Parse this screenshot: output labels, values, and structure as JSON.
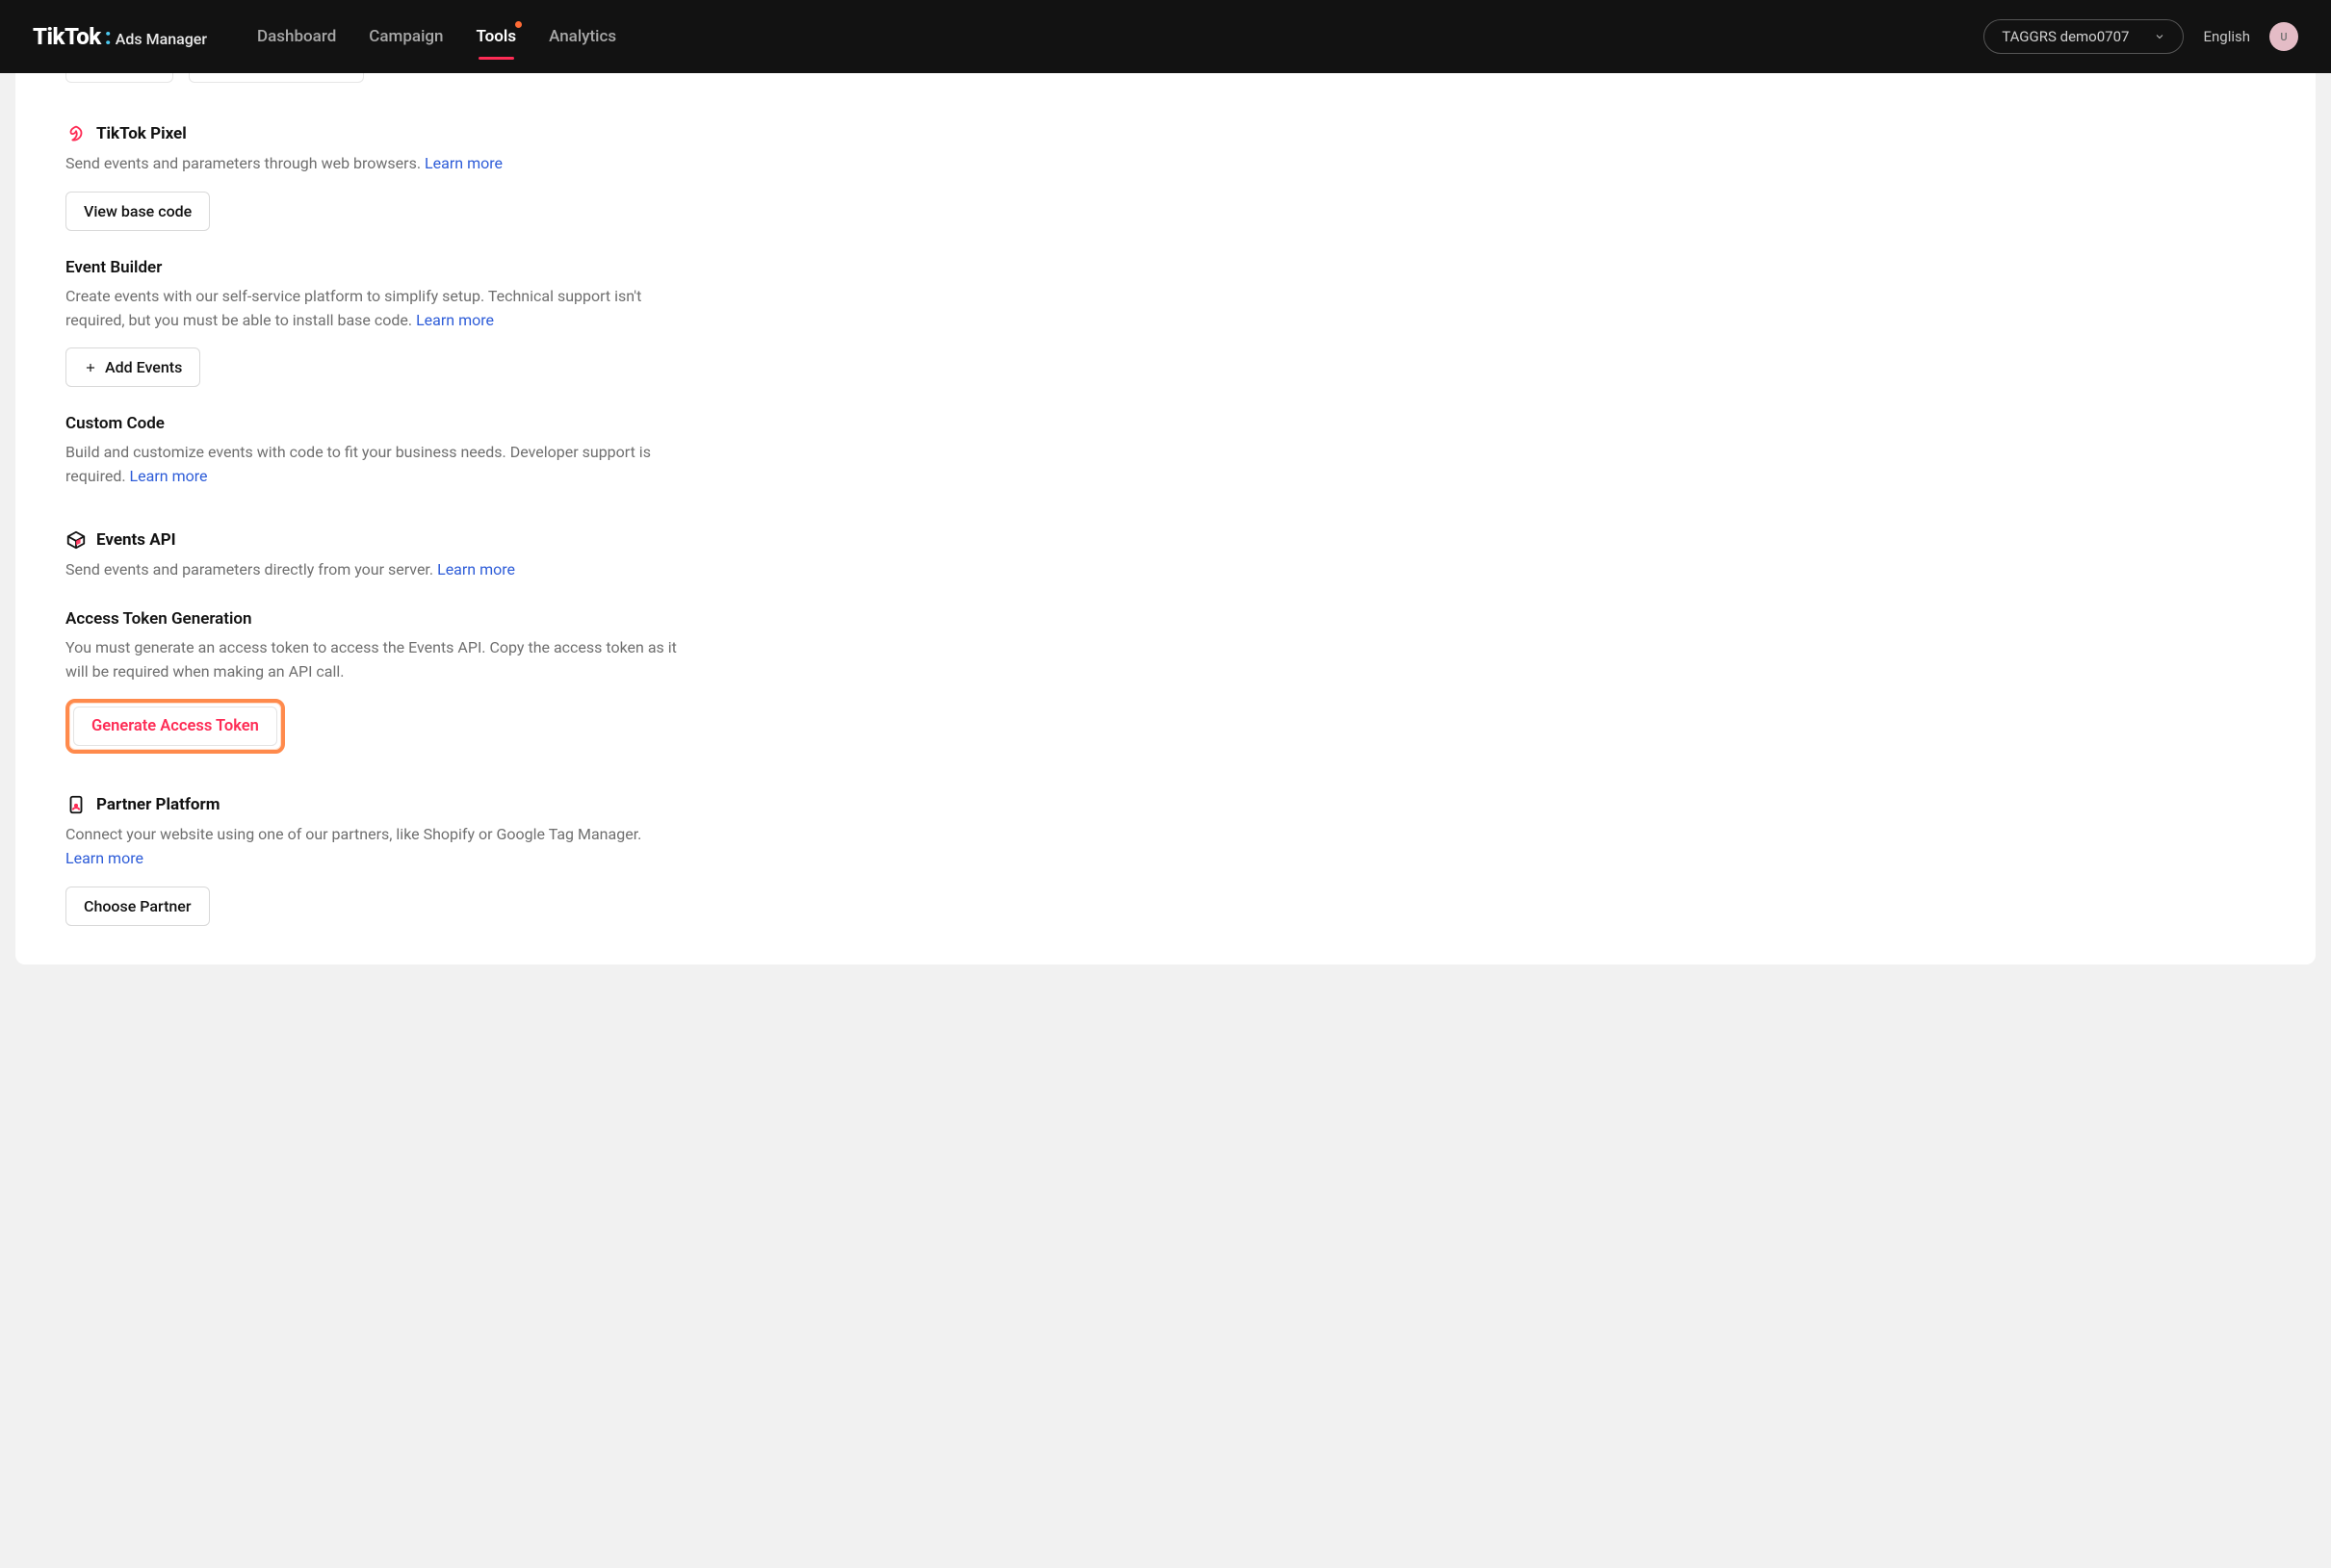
{
  "header": {
    "logo_brand": "TikTok",
    "logo_sub": "Ads Manager",
    "nav": [
      {
        "label": "Dashboard",
        "active": false,
        "notif": false
      },
      {
        "label": "Campaign",
        "active": false,
        "notif": false
      },
      {
        "label": "Tools",
        "active": true,
        "notif": true
      },
      {
        "label": "Analytics",
        "active": false,
        "notif": false
      }
    ],
    "account": "TAGGRS demo0707",
    "language": "English",
    "avatar_initial": "U"
  },
  "sections": {
    "pixel": {
      "title": "TikTok Pixel",
      "desc": "Send events and parameters through web browsers. ",
      "learn_more": "Learn more",
      "button_view_base": "View base code"
    },
    "event_builder": {
      "title": "Event Builder",
      "desc": "Create events with our self-service platform to simplify setup. Technical support isn't required, but you must be able to install base code. ",
      "learn_more": "Learn more",
      "button_add_events": "Add Events"
    },
    "custom_code": {
      "title": "Custom Code",
      "desc": "Build and customize events with code to fit your business needs. Developer support is required. ",
      "learn_more": "Learn more"
    },
    "events_api": {
      "title": "Events API",
      "desc": "Send events and parameters directly from your server. ",
      "learn_more": "Learn more"
    },
    "access_token": {
      "title": "Access Token Generation",
      "desc": "You must generate an access token to access the Events API. Copy the access token as it will be required when making an API call.",
      "button_generate": "Generate Access Token"
    },
    "partner": {
      "title": "Partner Platform",
      "desc": "Connect your website using one of our partners, like Shopify or Google Tag Manager. ",
      "learn_more": "Learn more",
      "button_choose": "Choose Partner"
    }
  }
}
